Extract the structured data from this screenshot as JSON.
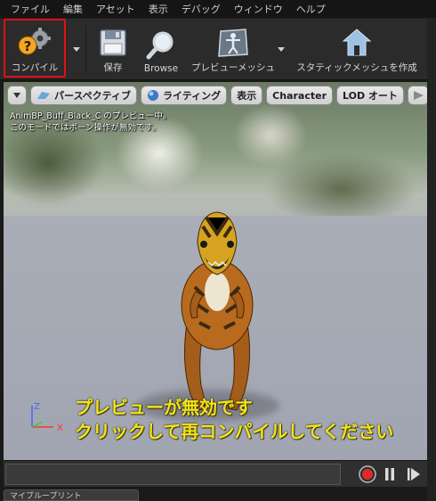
{
  "menu": [
    "ファイル",
    "編集",
    "アセット",
    "表示",
    "デバッグ",
    "ウィンドウ",
    "ヘルプ"
  ],
  "toolbar": {
    "compile_label": "コンパイル",
    "save_label": "保存",
    "browse_label": "Browse",
    "preview_mesh_label": "プレビューメッシュ",
    "make_static_mesh_label": "スタティックメッシュを作成"
  },
  "viewport": {
    "perspective_label": "パースペクティブ",
    "lighting_label": "ライティング",
    "show_label": "表示",
    "character_label": "Character",
    "lod_label": "LOD オート",
    "info_line1": "AnimBP_Buff_Black_C のプレビュー中。",
    "info_line2": "このモードではボーン操作が無効です。",
    "warning_line1": "プレビューが無効です",
    "warning_line2": "クリックして再コンパイルしてください",
    "axis_z": "Z",
    "axis_x": "X"
  },
  "bottom_tab_label": "マイブループリント",
  "colors": {
    "highlight": "#e01010",
    "warning_text": "#f3e31c",
    "record": "#e02a2a"
  }
}
